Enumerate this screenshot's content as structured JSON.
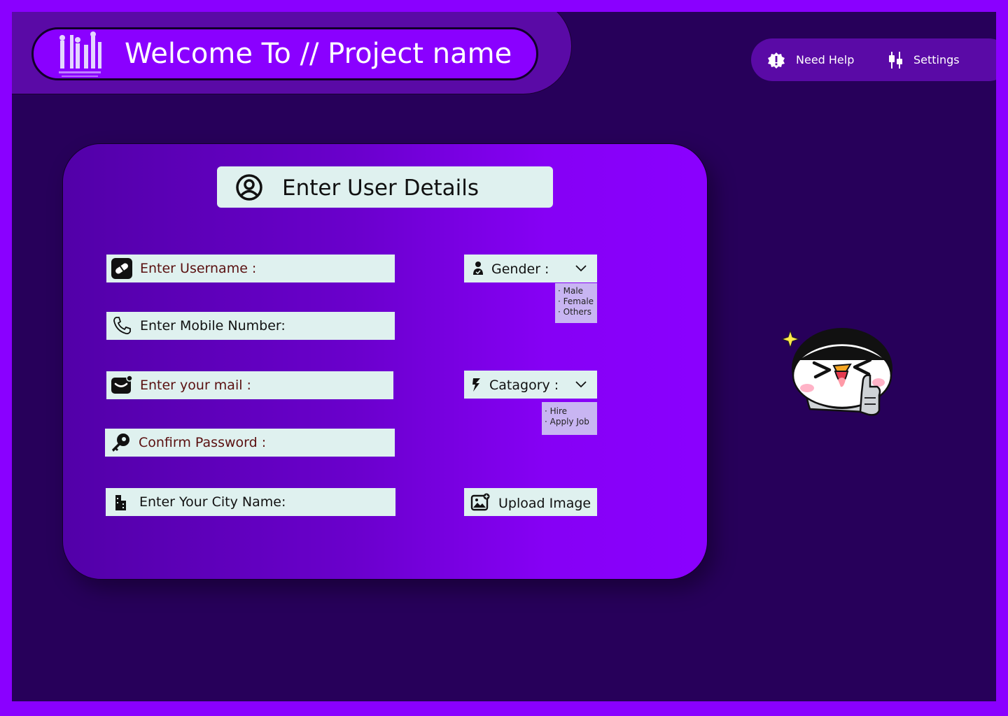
{
  "header": {
    "title": "Welcome To // Project name",
    "logo_icon": "team-silhouette-logo"
  },
  "nav": {
    "help_label": "Need Help",
    "settings_label": "Settings"
  },
  "form": {
    "title": "Enter User Details",
    "username_placeholder": "Enter Username :",
    "mobile_placeholder": "Enter Mobile Number:",
    "mail_placeholder": "Enter your mail :",
    "password_placeholder": "Confirm Password :",
    "city_placeholder": "Enter Your City Name:",
    "gender_label": "Gender :",
    "gender_options": [
      "Male",
      "Female",
      "Others"
    ],
    "category_label": "Catagory :",
    "category_options": [
      "Hire",
      "Apply Job"
    ],
    "upload_label": "Upload Image"
  },
  "colors": {
    "frame": "#8a00ff",
    "background": "#27005a",
    "field": "#dff1ef",
    "placeholder_dark_red": "#5a1010",
    "dropdown_options": "#c8b5f2"
  },
  "mascot": "penguin-thumbs-up-sticker"
}
